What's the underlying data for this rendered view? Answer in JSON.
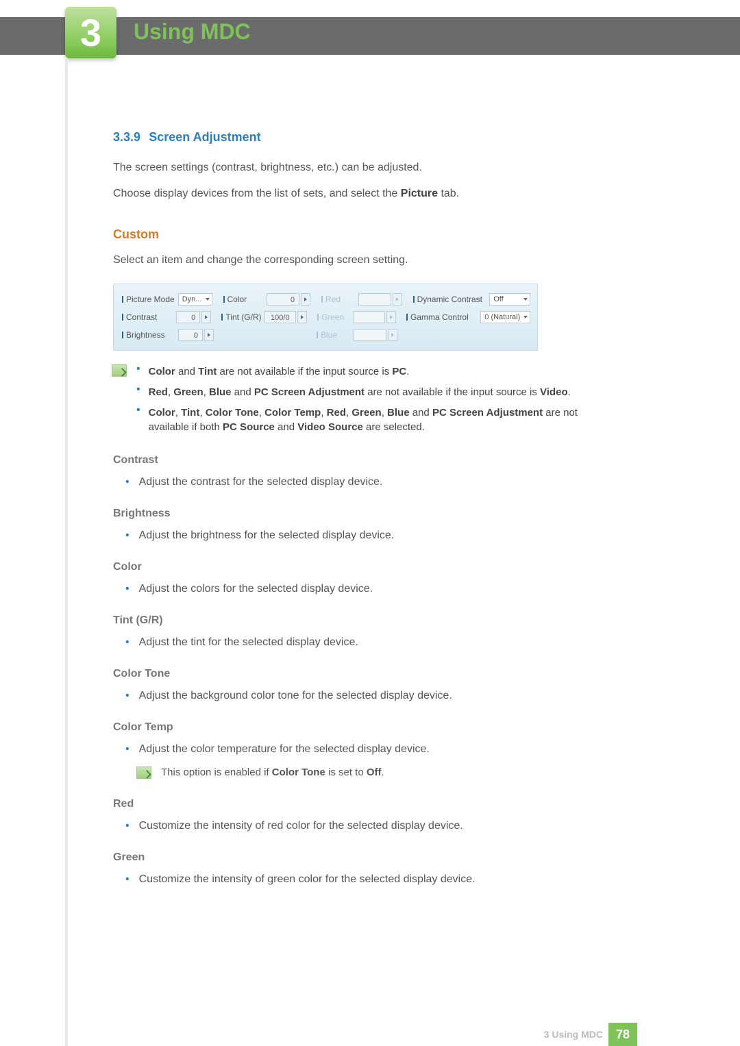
{
  "header": {
    "chapter_number": "3",
    "title": "Using MDC"
  },
  "section": {
    "number": "3.3.9",
    "title": "Screen Adjustment",
    "intro1": "The screen settings (contrast, brightness, etc.) can be adjusted.",
    "intro2_prefix": "Choose display devices from the list of sets, and select the ",
    "intro2_bold": "Picture",
    "intro2_suffix": " tab."
  },
  "custom": {
    "heading": "Custom",
    "desc": "Select an item and change the corresponding screen setting."
  },
  "panel": {
    "picture_mode": {
      "label": "Picture Mode",
      "value": "Dyn..."
    },
    "contrast": {
      "label": "Contrast",
      "value": "0"
    },
    "brightness": {
      "label": "Brightness",
      "value": "0"
    },
    "color": {
      "label": "Color",
      "value": "0"
    },
    "tint": {
      "label": "Tint (G/R)",
      "value": "100/0"
    },
    "red": {
      "label": "Red",
      "value": ""
    },
    "green": {
      "label": "Green",
      "value": ""
    },
    "blue": {
      "label": "Blue",
      "value": ""
    },
    "dynamic_contrast": {
      "label": "Dynamic Contrast",
      "value": "Off"
    },
    "gamma_control": {
      "label": "Gamma Control",
      "value": "0 (Natural)"
    }
  },
  "notes": {
    "n1": {
      "b1": "Color",
      "and": " and ",
      "b2": "Tint",
      "rest": " are not available if the input source is ",
      "b3": "PC",
      "end": "."
    },
    "n2": {
      "b1": "Red",
      "c1": ", ",
      "b2": "Green",
      "c2": ", ",
      "b3": "Blue",
      "and": " and ",
      "b4": "PC Screen Adjustment",
      "rest": " are not available if the input source is ",
      "b5": "Video",
      "end": "."
    },
    "n3": {
      "b1": "Color",
      "c1": ", ",
      "b2": "Tint",
      "c2": ", ",
      "b3": "Color Tone",
      "c3": ", ",
      "b4": "Color Temp",
      "c4": ", ",
      "b5": "Red",
      "c5": ", ",
      "b6": "Green",
      "c6": ", ",
      "b7": "Blue",
      "and": " and ",
      "b8": "PC Screen Adjustment",
      "rest1": " are not available if both ",
      "b9": "PC Source",
      "and2": " and ",
      "b10": "Video Source",
      "rest2": " are selected."
    }
  },
  "settings": {
    "contrast": {
      "title": "Contrast",
      "desc": "Adjust the contrast for the selected display device."
    },
    "brightness": {
      "title": "Brightness",
      "desc": "Adjust the brightness for the selected display device."
    },
    "color": {
      "title": "Color",
      "desc": "Adjust the colors for the selected display device."
    },
    "tint": {
      "title": "Tint (G/R)",
      "desc": "Adjust the tint for the selected display device."
    },
    "color_tone": {
      "title": "Color Tone",
      "desc": "Adjust the background color tone for the selected display device."
    },
    "color_temp": {
      "title": "Color Temp",
      "desc": "Adjust the color temperature for the selected display device.",
      "note_prefix": "This option is enabled if ",
      "note_b1": "Color Tone",
      "note_mid": " is set to ",
      "note_b2": "Off",
      "note_end": "."
    },
    "red": {
      "title": "Red",
      "desc": "Customize the intensity of red color for the selected display device."
    },
    "green": {
      "title": "Green",
      "desc": "Customize the intensity of green color for the selected display device."
    }
  },
  "footer": {
    "text_prefix": "3",
    "text": "Using MDC",
    "page": "78"
  }
}
